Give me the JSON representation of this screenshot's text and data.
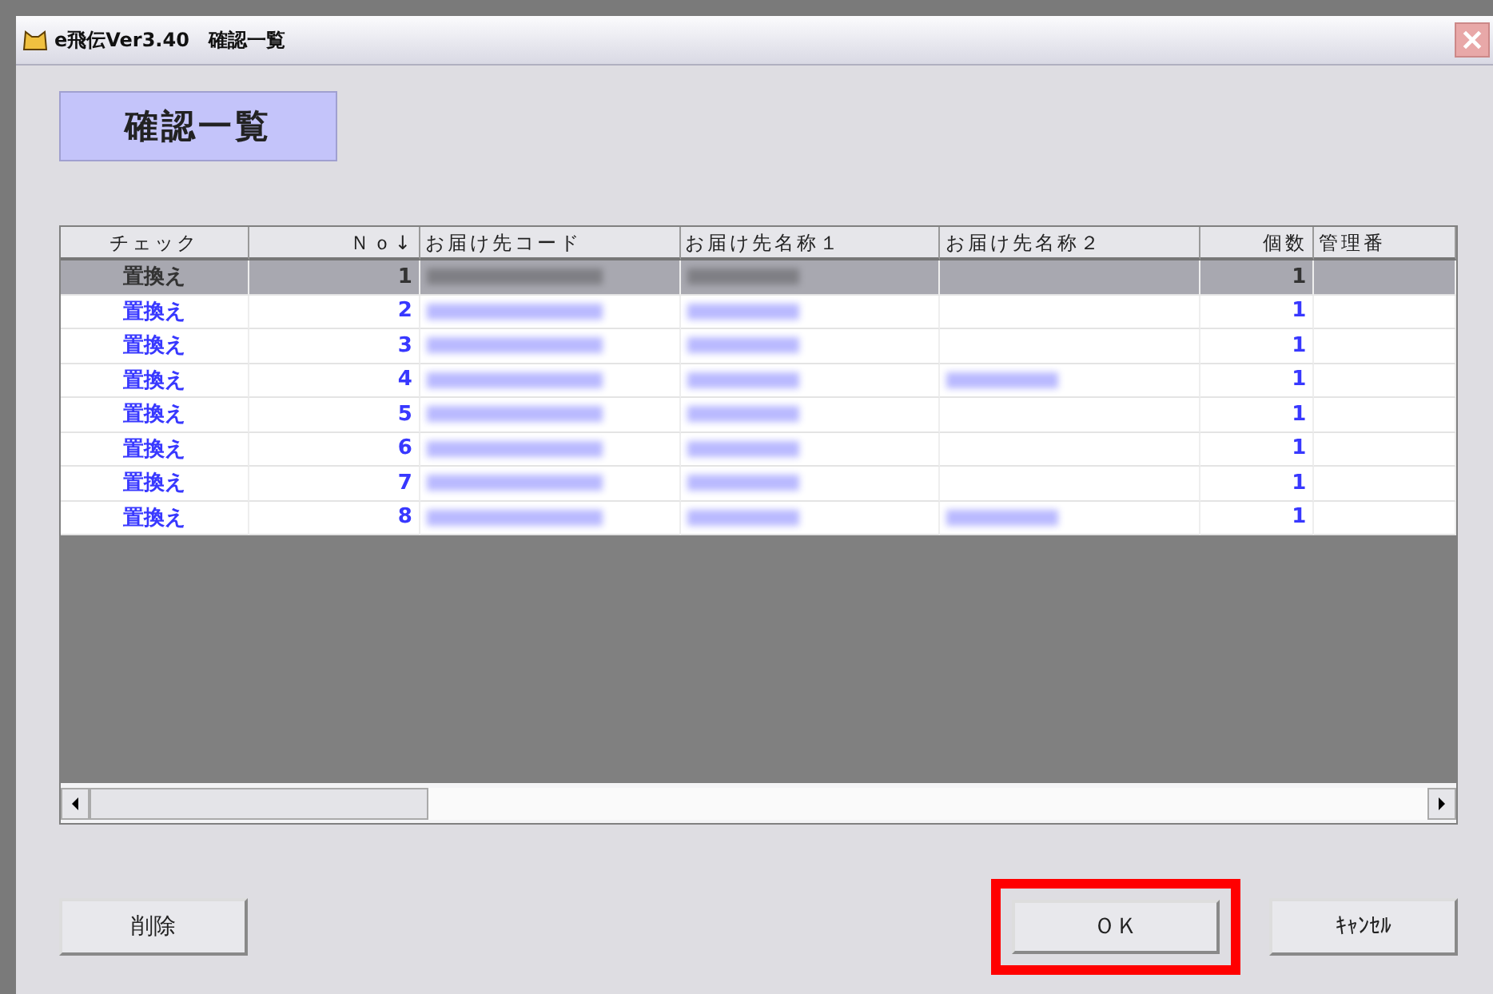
{
  "window": {
    "title": "e飛伝Ver3.40　確認一覧"
  },
  "heading": "確認一覧",
  "table": {
    "columns": [
      "チェック",
      "Ｎｏ↓",
      "お届け先コード",
      "お届け先名称１",
      "お届け先名称２",
      "個数",
      "管理番"
    ],
    "rows": [
      {
        "selected": true,
        "cells": [
          {
            "kind": "text",
            "text": "置換え"
          },
          {
            "kind": "text",
            "text": "1"
          },
          {
            "kind": "blurred"
          },
          {
            "kind": "blurred"
          },
          {
            "kind": "empty"
          },
          {
            "kind": "text",
            "text": "1"
          },
          {
            "kind": "empty"
          }
        ]
      },
      {
        "selected": false,
        "cells": [
          {
            "kind": "text",
            "text": "置換え"
          },
          {
            "kind": "text",
            "text": "2"
          },
          {
            "kind": "blurred"
          },
          {
            "kind": "blurred"
          },
          {
            "kind": "empty"
          },
          {
            "kind": "text",
            "text": "1"
          },
          {
            "kind": "empty"
          }
        ]
      },
      {
        "selected": false,
        "cells": [
          {
            "kind": "text",
            "text": "置換え"
          },
          {
            "kind": "text",
            "text": "3"
          },
          {
            "kind": "blurred"
          },
          {
            "kind": "blurred"
          },
          {
            "kind": "empty"
          },
          {
            "kind": "text",
            "text": "1"
          },
          {
            "kind": "empty"
          }
        ]
      },
      {
        "selected": false,
        "cells": [
          {
            "kind": "text",
            "text": "置換え"
          },
          {
            "kind": "text",
            "text": "4"
          },
          {
            "kind": "blurred"
          },
          {
            "kind": "blurred"
          },
          {
            "kind": "blurred"
          },
          {
            "kind": "text",
            "text": "1"
          },
          {
            "kind": "empty"
          }
        ]
      },
      {
        "selected": false,
        "cells": [
          {
            "kind": "text",
            "text": "置換え"
          },
          {
            "kind": "text",
            "text": "5"
          },
          {
            "kind": "blurred"
          },
          {
            "kind": "blurred"
          },
          {
            "kind": "empty"
          },
          {
            "kind": "text",
            "text": "1"
          },
          {
            "kind": "empty"
          }
        ]
      },
      {
        "selected": false,
        "cells": [
          {
            "kind": "text",
            "text": "置換え"
          },
          {
            "kind": "text",
            "text": "6"
          },
          {
            "kind": "blurred"
          },
          {
            "kind": "blurred"
          },
          {
            "kind": "empty"
          },
          {
            "kind": "text",
            "text": "1"
          },
          {
            "kind": "empty"
          }
        ]
      },
      {
        "selected": false,
        "cells": [
          {
            "kind": "text",
            "text": "置換え"
          },
          {
            "kind": "text",
            "text": "7"
          },
          {
            "kind": "blurred"
          },
          {
            "kind": "blurred"
          },
          {
            "kind": "empty"
          },
          {
            "kind": "text",
            "text": "1"
          },
          {
            "kind": "empty"
          }
        ]
      },
      {
        "selected": false,
        "cells": [
          {
            "kind": "text",
            "text": "置換え"
          },
          {
            "kind": "text",
            "text": "8"
          },
          {
            "kind": "blurred"
          },
          {
            "kind": "blurred"
          },
          {
            "kind": "blurred"
          },
          {
            "kind": "text",
            "text": "1"
          },
          {
            "kind": "empty"
          }
        ]
      }
    ]
  },
  "buttons": [
    {
      "label": "削除",
      "highlighted": false
    },
    {
      "label": "ＯＫ",
      "highlighted": true
    },
    {
      "label": "ｷｬﾝｾﾙ",
      "highlighted": false
    }
  ]
}
